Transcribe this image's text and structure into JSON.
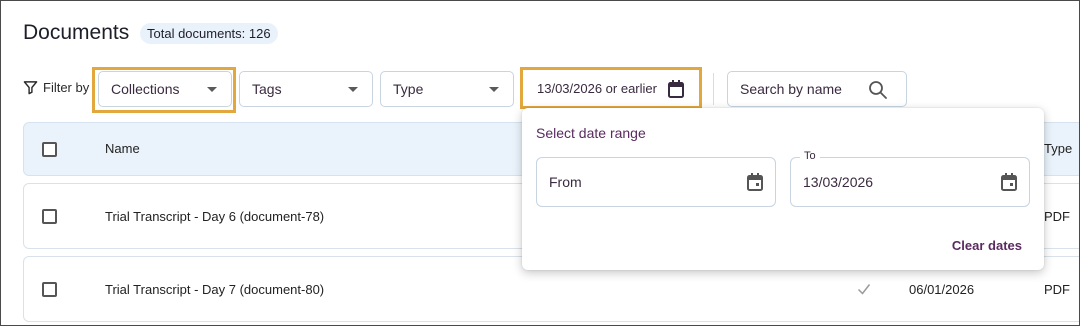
{
  "header": {
    "title": "Documents",
    "total_label": "Total documents: 126"
  },
  "filters": {
    "filter_by_label": "Filter by",
    "collections": "Collections",
    "tags": "Tags",
    "type": "Type",
    "date_button": "13/03/2026 or earlier",
    "search_placeholder": "Search by name"
  },
  "table": {
    "columns": {
      "name": "Name",
      "type": "Type"
    },
    "rows": [
      {
        "name": "Trial Transcript - Day 6 (document-78)",
        "date": "",
        "type": "PDF",
        "checked_icon": false
      },
      {
        "name": "Trial Transcript - Day 7 (document-80)",
        "date": "06/01/2026",
        "type": "PDF",
        "checked_icon": true
      }
    ]
  },
  "date_popover": {
    "title": "Select date range",
    "from_value": "From",
    "to_label": "To",
    "to_value": "13/03/2026",
    "clear_label": "Clear dates"
  },
  "colors": {
    "highlight": "#e2a73d",
    "accent": "#5a2a60",
    "header_bg": "#eaf3fb",
    "pill_bg": "#e9f2fb"
  },
  "icons": [
    "filter-icon",
    "calendar-icon",
    "search-icon",
    "checkmark-icon",
    "dropdown-caret-icon"
  ]
}
